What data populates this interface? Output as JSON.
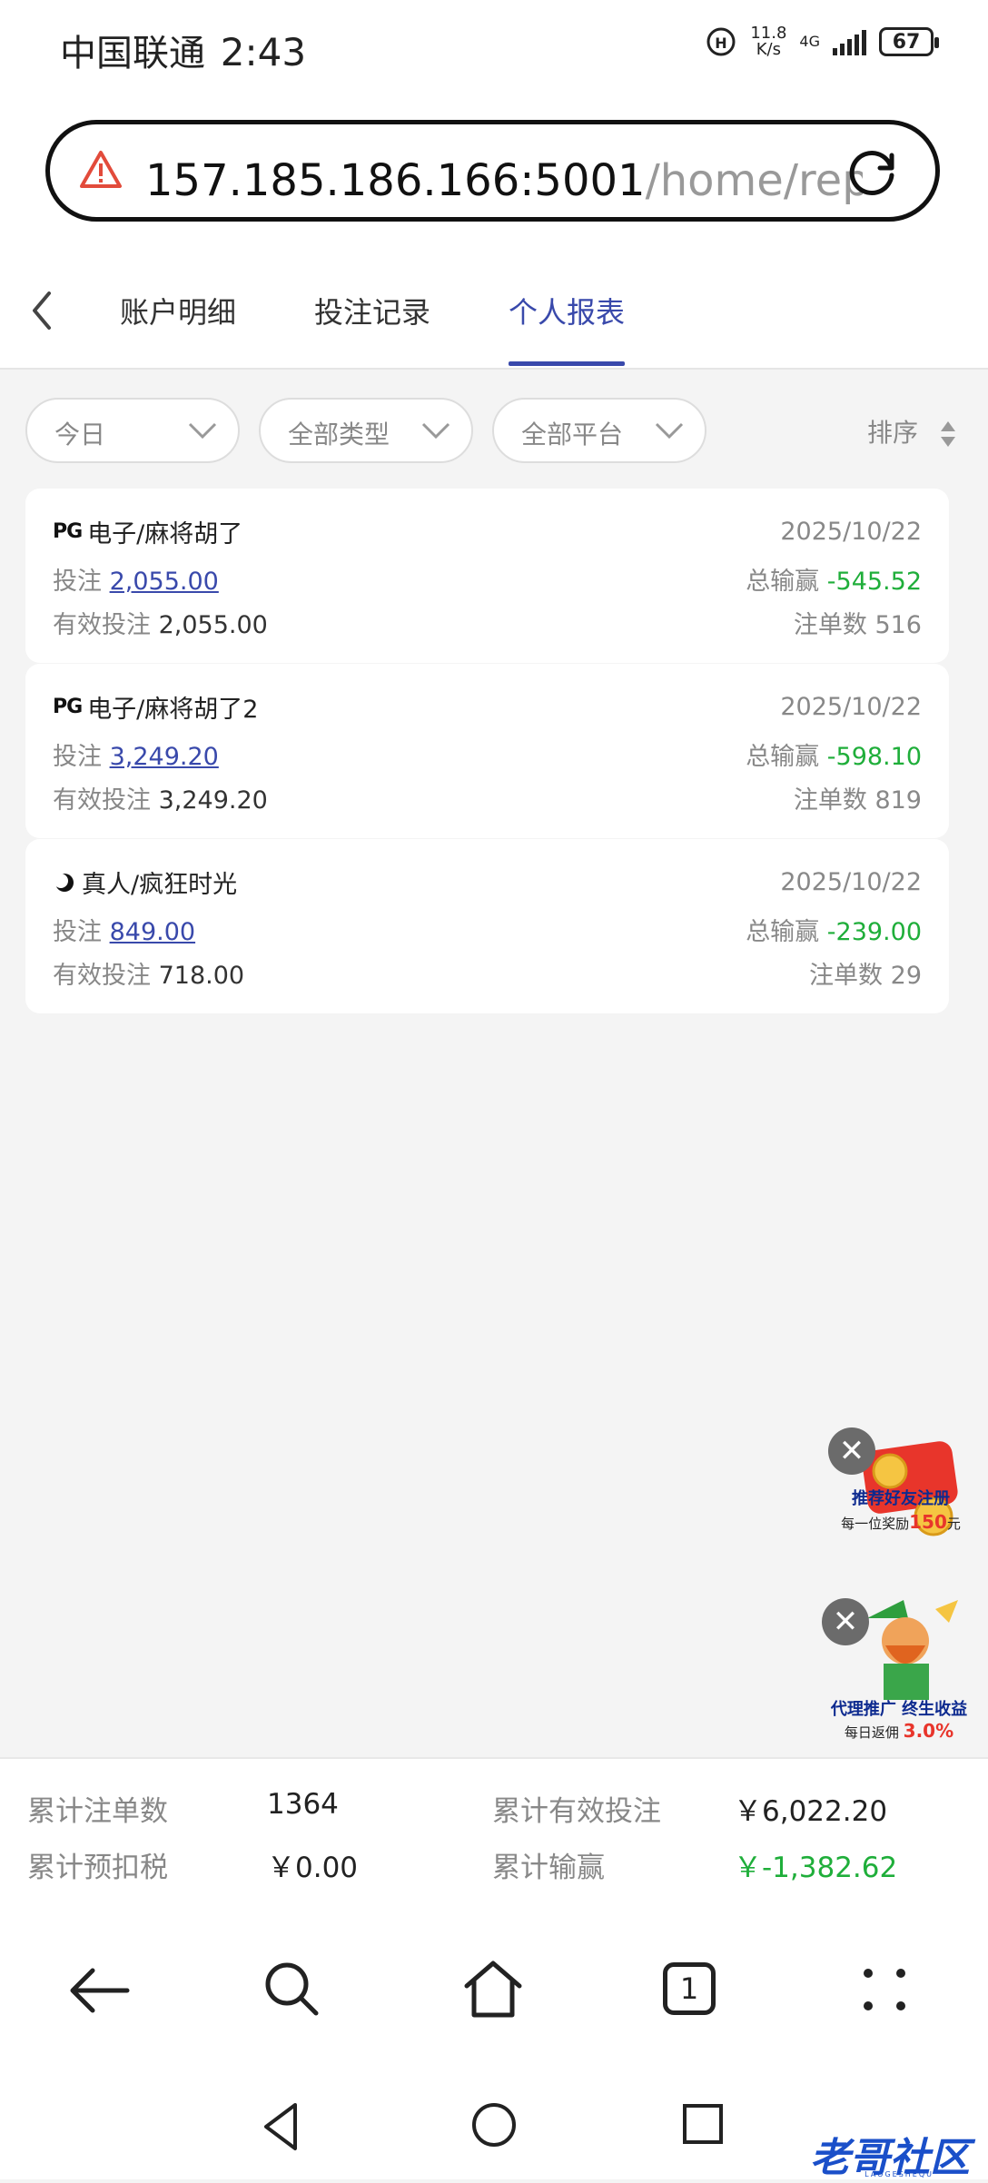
{
  "status_bar": {
    "carrier": "中国联通",
    "time": "2:43",
    "speed_value": "11.8",
    "speed_unit": "K/s",
    "network": "4G",
    "battery": "67"
  },
  "browser": {
    "url_host": "157.185.186.166:5001",
    "url_path": "/home/repo"
  },
  "tabs": [
    {
      "label": "账户明细"
    },
    {
      "label": "投注记录"
    },
    {
      "label": "个人报表",
      "active": true
    }
  ],
  "filters": {
    "date": "今日",
    "type": "全部类型",
    "platform": "全部平台",
    "sort": "排序"
  },
  "records": [
    {
      "platform_logo": "PG",
      "game": "电子/麻将胡了",
      "date": "2025/10/22",
      "bet_label": "投注",
      "bet": "2,055.00",
      "win_label": "总输赢",
      "win": "-545.52",
      "valid_label": "有效投注",
      "valid": "2,055.00",
      "orders_label": "注单数",
      "orders": "516"
    },
    {
      "platform_logo": "PG",
      "game": "电子/麻将胡了2",
      "date": "2025/10/22",
      "bet_label": "投注",
      "bet": "3,249.20",
      "win_label": "总输赢",
      "win": "-598.10",
      "valid_label": "有效投注",
      "valid": "3,249.20",
      "orders_label": "注单数",
      "orders": "819"
    },
    {
      "platform_logo": "",
      "game": "真人/疯狂时光",
      "date": "2025/10/22",
      "bet_label": "投注",
      "bet": "849.00",
      "win_label": "总输赢",
      "win": "-239.00",
      "valid_label": "有效投注",
      "valid": "718.00",
      "orders_label": "注单数",
      "orders": "29"
    }
  ],
  "promos": [
    {
      "title": "推荐好友注册",
      "sub_prefix": "每一位奖励",
      "sub_amount": "150",
      "sub_suffix": "元"
    },
    {
      "title": "代理推广 终生收益",
      "sub_prefix": "每日返佣",
      "sub_amount": "3.0%",
      "sub_suffix": ""
    }
  ],
  "summary": {
    "total_orders_label": "累计注单数",
    "total_orders": "1364",
    "total_valid_label": "累计有效投注",
    "total_valid": "￥6,022.20",
    "tax_label": "累计预扣税",
    "tax": "￥0.00",
    "total_win_label": "累计输赢",
    "total_win": "￥-1,382.62"
  },
  "browser_nav": {
    "tab_count": "1"
  },
  "watermark": {
    "text": "老哥社区",
    "sub": "LAOGESHEQU"
  },
  "colors": {
    "accent": "#3949ab",
    "win_green": "#1fae3a",
    "background": "#f4f4f4"
  }
}
